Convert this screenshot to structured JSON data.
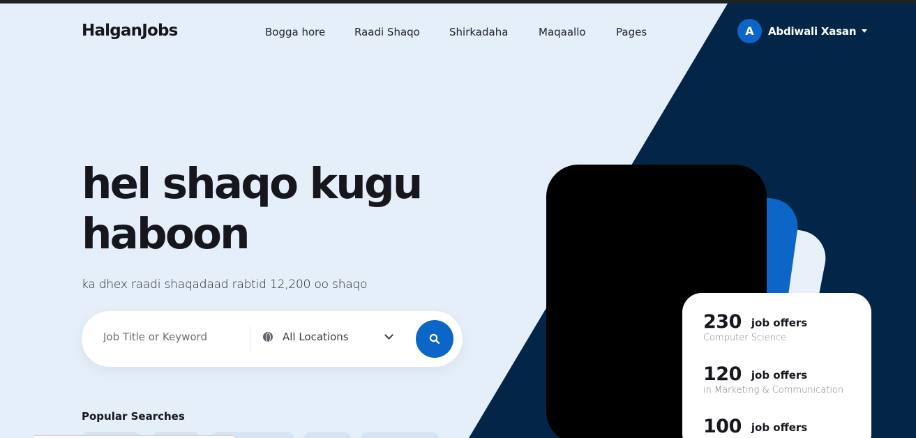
{
  "brand": {
    "logo": "HalganJobs"
  },
  "nav": {
    "items": [
      "Bogga hore",
      "Raadi Shaqo",
      "Shirkadaha",
      "Maqaallo",
      "Pages"
    ]
  },
  "user": {
    "initial": "A",
    "name": "Abdiwali Xasan"
  },
  "hero": {
    "title_line1": "hel shaqo kugu",
    "title_line2": "haboon",
    "subtitle": "ka dhex raadi shaqadaad rabtid 12,200 oo shaqo"
  },
  "search": {
    "keyword_placeholder": "Job Title or Keyword",
    "location_value": "All Locations",
    "location_icon": "globe-icon",
    "button_icon": "search-icon"
  },
  "popular": {
    "heading": "Popular Searches"
  },
  "stats": [
    {
      "count": "230",
      "label": "job offers",
      "category": "Computer Science"
    },
    {
      "count": "120",
      "label": "job offers",
      "category": "in Marketing & Communication"
    },
    {
      "count": "100",
      "label": "job offers",
      "category": ""
    }
  ],
  "colors": {
    "primary": "#0b66c8",
    "dark_navy": "#022548",
    "hero_bg": "#e4eff9",
    "text": "#16161d"
  }
}
